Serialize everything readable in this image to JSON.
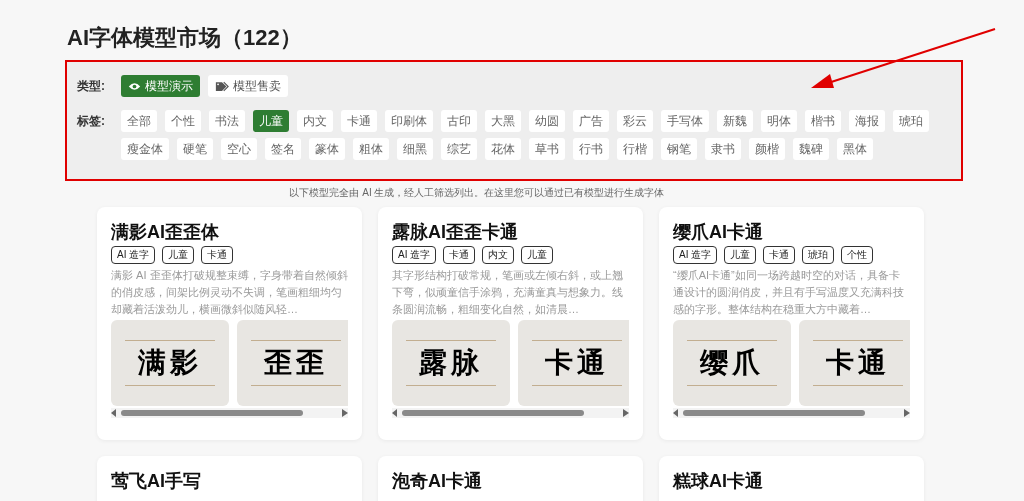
{
  "page_title": "AI字体模型市场（122）",
  "filters": {
    "type_label": "类型:",
    "types": [
      {
        "label": "模型演示",
        "selected": true,
        "kind": "eye"
      },
      {
        "label": "模型售卖",
        "selected": false,
        "kind": "tag"
      }
    ],
    "tag_label": "标签:",
    "tags": [
      {
        "label": "全部",
        "selected": false
      },
      {
        "label": "个性",
        "selected": false
      },
      {
        "label": "书法",
        "selected": false
      },
      {
        "label": "儿童",
        "selected": true
      },
      {
        "label": "内文",
        "selected": false
      },
      {
        "label": "卡通",
        "selected": false
      },
      {
        "label": "印刷体",
        "selected": false
      },
      {
        "label": "古印",
        "selected": false
      },
      {
        "label": "大黑",
        "selected": false
      },
      {
        "label": "幼圆",
        "selected": false
      },
      {
        "label": "广告",
        "selected": false
      },
      {
        "label": "彩云",
        "selected": false
      },
      {
        "label": "手写体",
        "selected": false
      },
      {
        "label": "新魏",
        "selected": false
      },
      {
        "label": "明体",
        "selected": false
      },
      {
        "label": "楷书",
        "selected": false
      },
      {
        "label": "海报",
        "selected": false
      },
      {
        "label": "琥珀",
        "selected": false
      },
      {
        "label": "瘦金体",
        "selected": false
      },
      {
        "label": "硬笔",
        "selected": false
      },
      {
        "label": "空心",
        "selected": false
      },
      {
        "label": "签名",
        "selected": false
      },
      {
        "label": "篆体",
        "selected": false
      },
      {
        "label": "粗体",
        "selected": false
      },
      {
        "label": "细黑",
        "selected": false
      },
      {
        "label": "综艺",
        "selected": false
      },
      {
        "label": "花体",
        "selected": false
      },
      {
        "label": "草书",
        "selected": false
      },
      {
        "label": "行书",
        "selected": false
      },
      {
        "label": "行楷",
        "selected": false
      },
      {
        "label": "钢笔",
        "selected": false
      },
      {
        "label": "隶书",
        "selected": false
      },
      {
        "label": "颜楷",
        "selected": false
      },
      {
        "label": "魏碑",
        "selected": false
      },
      {
        "label": "黑体",
        "selected": false
      }
    ]
  },
  "notice": "以下模型完全由 AI 生成，经人工筛选列出。在这里您可以通过已有模型进行生成字体",
  "cards": [
    {
      "title": "满影AI歪歪体",
      "tags": [
        "AI 造字",
        "儿童",
        "卡通"
      ],
      "description": "满影 AI 歪歪体打破规整束缚，字身带着自然倾斜的俏皮感，间架比例灵动不失调，笔画粗细均匀却藏着活泼劲儿，横画微斜似随风轻…",
      "samples": [
        "满影",
        "歪歪"
      ]
    },
    {
      "title": "露脉AI歪歪卡通",
      "tags": [
        "AI 造字",
        "卡通",
        "内文",
        "儿童"
      ],
      "description": "其字形结构打破常规，笔画或左倾右斜，或上翘下弯，似顽童信手涂鸦，充满童真与想象力。线条圆润流畅，粗细变化自然，如清晨…",
      "samples": [
        "露脉",
        "卡通"
      ]
    },
    {
      "title": "缨爪AI卡通",
      "tags": [
        "AI 造字",
        "儿童",
        "卡通",
        "琥珀",
        "个性"
      ],
      "description": "“缨爪AI卡通”如同一场跨越时空的对话，具备卡通设计的圆润俏皮，并且有手写温度又充满科技感的字形。整体结构在稳重大方中藏着…",
      "samples": [
        "缨爪",
        "卡通"
      ]
    },
    {
      "title": "莺飞AI手写"
    },
    {
      "title": "泡奇AI卡通"
    },
    {
      "title": "糕球AI卡通"
    }
  ]
}
